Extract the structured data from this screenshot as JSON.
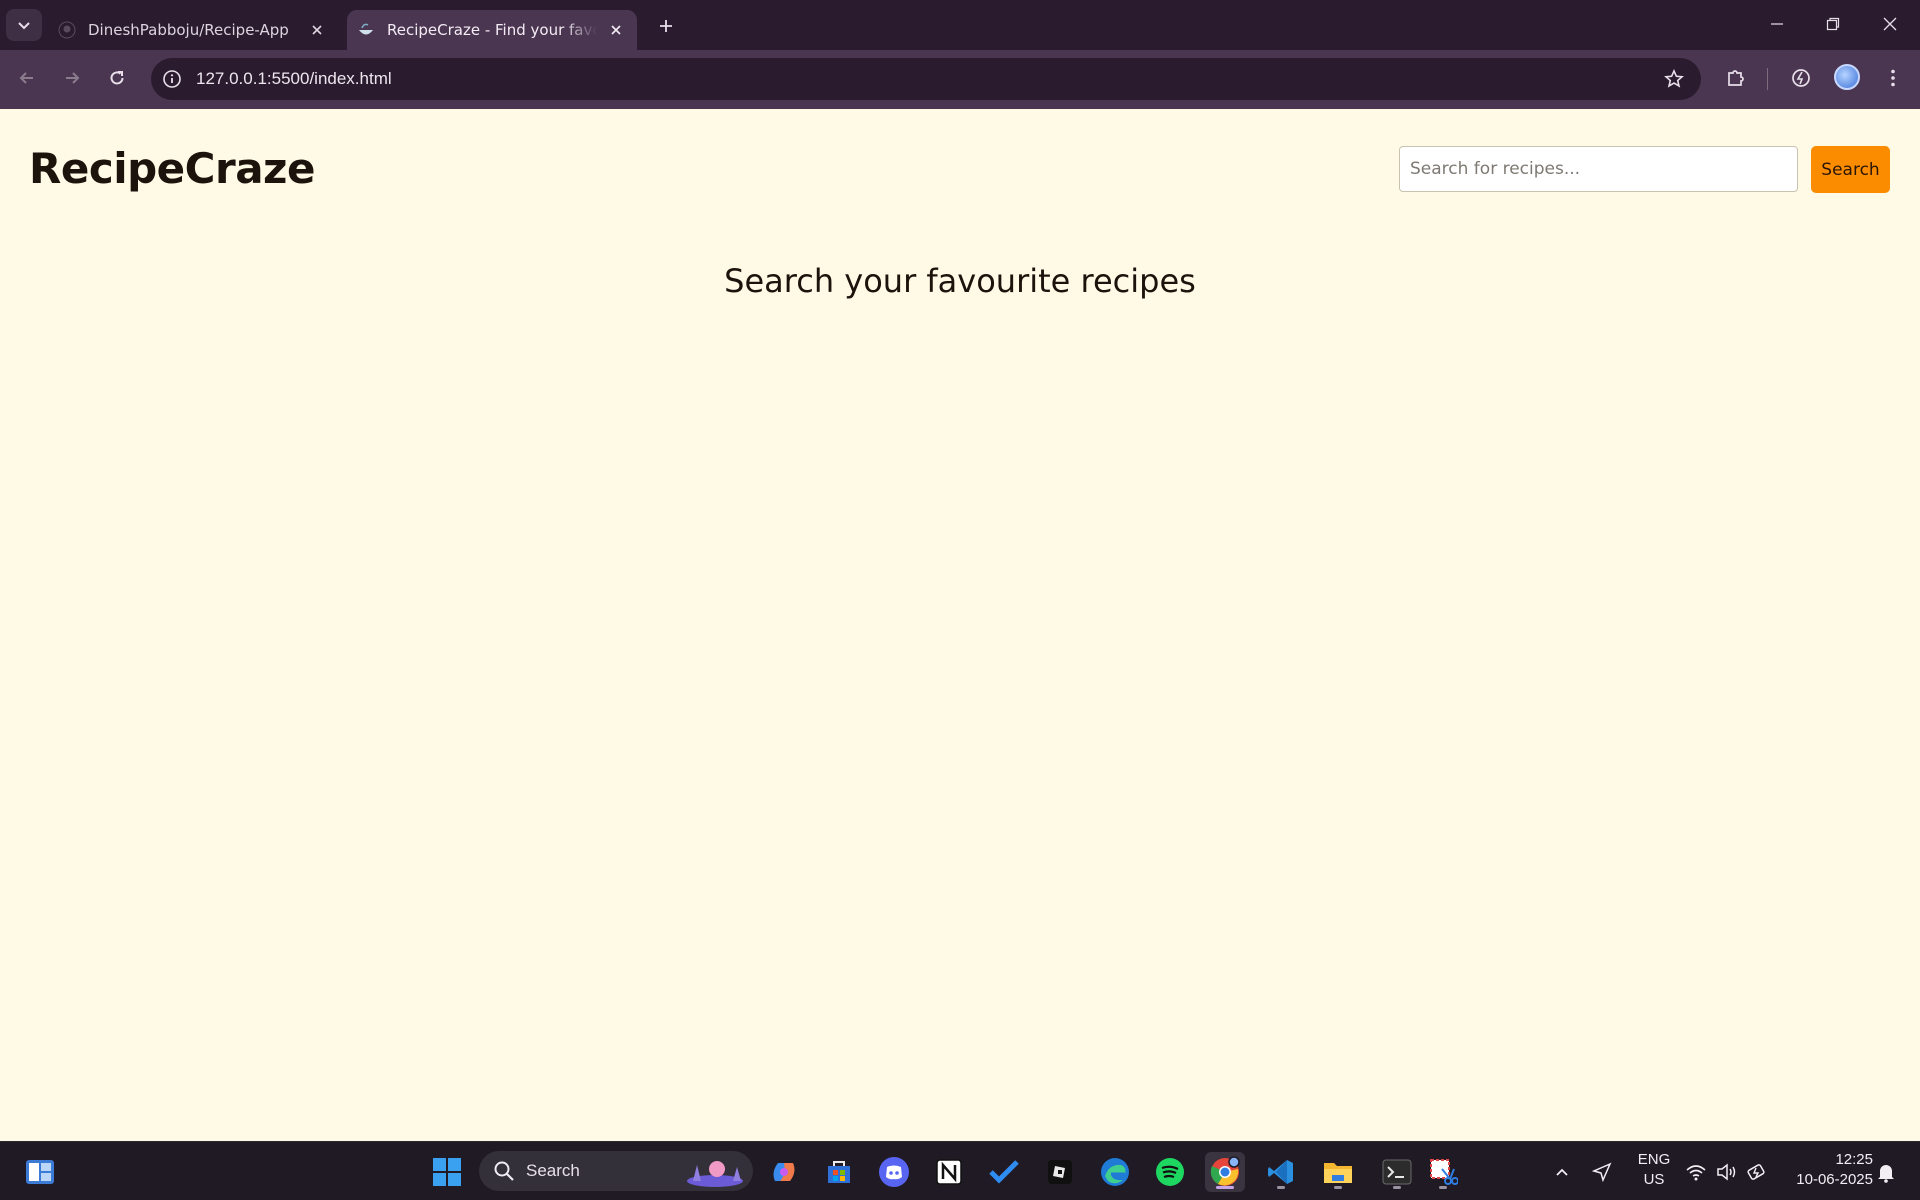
{
  "browser": {
    "tabs": [
      {
        "title": "DineshPabboju/Recipe-App",
        "favicon": "github-icon",
        "active": false
      },
      {
        "title": "RecipeCraze - Find your favourite recipes",
        "favicon": "bowl-icon",
        "active": true
      }
    ],
    "url": "127.0.0.1:5500/index.html"
  },
  "page": {
    "logo": "RecipeCraze",
    "search": {
      "placeholder": "Search for recipes...",
      "value": "",
      "button_label": "Search"
    },
    "headline": "Search your favourite recipes"
  },
  "colors": {
    "page_bg": "#fffae6",
    "accent": "#fb8c00",
    "chrome": "#2a1c2e",
    "toolbar": "#4a3650"
  },
  "taskbar": {
    "search_label": "Search",
    "apps": [
      "start-icon",
      "copilot-icon",
      "microsoft-store-icon",
      "discord-icon",
      "notion-icon",
      "todo-icon",
      "roblox-icon",
      "edge-icon",
      "spotify-icon",
      "chrome-icon",
      "vscode-icon",
      "file-explorer-icon",
      "terminal-icon",
      "snipping-tool-icon"
    ],
    "language": {
      "line1": "ENG",
      "line2": "US"
    },
    "clock": {
      "time": "12:25",
      "date": "10-06-2025"
    }
  }
}
